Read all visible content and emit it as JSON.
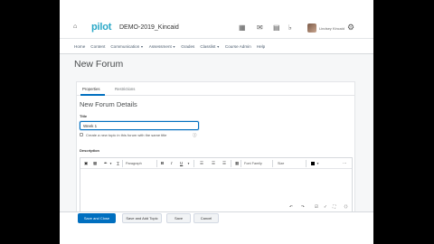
{
  "header": {
    "logo_text": "pilot",
    "course_title": "DEMO-2019_Kincaid",
    "username": "Lindsey Kincaid"
  },
  "navbar": {
    "items": [
      {
        "label": "Home",
        "has_caret": false
      },
      {
        "label": "Content",
        "has_caret": false
      },
      {
        "label": "Communication",
        "has_caret": true
      },
      {
        "label": "Assessment",
        "has_caret": true
      },
      {
        "label": "Grades",
        "has_caret": false
      },
      {
        "label": "Classlist",
        "has_caret": true
      },
      {
        "label": "Course Admin",
        "has_caret": false
      },
      {
        "label": "Help",
        "has_caret": false
      }
    ]
  },
  "page": {
    "title": "New Forum"
  },
  "tabs": {
    "properties": "Properties",
    "restrictions": "Restrictions"
  },
  "form": {
    "section_title": "New Forum Details",
    "title_label": "Title",
    "title_value": "Week 1",
    "checkbox_label": "Create a new topic in this forum with the same title",
    "description_label": "Description"
  },
  "editor": {
    "format_label": "Paragraph",
    "font_label": "Font Family",
    "size_label": "Size",
    "color_hex": "#000000"
  },
  "footer": {
    "save_close": "Save and Close",
    "save_add_topic": "Save and Add Topic",
    "save": "Save",
    "cancel": "Cancel"
  },
  "colors": {
    "brand": "#2aa8c7",
    "primary_button": "#006fbf"
  }
}
